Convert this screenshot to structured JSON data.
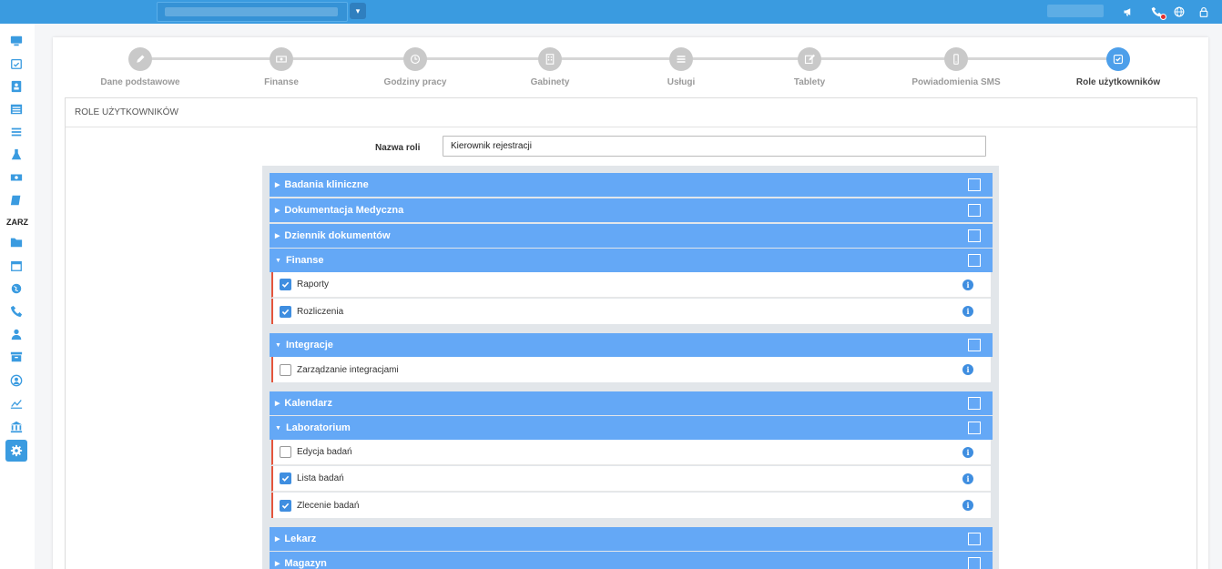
{
  "topbar": {
    "caret": "▾"
  },
  "sidebar": {
    "section_label": "ZARZ"
  },
  "stepper": {
    "steps": [
      {
        "label": "Dane podstawowe",
        "icon": "pencil-icon"
      },
      {
        "label": "Finanse",
        "icon": "money-icon"
      },
      {
        "label": "Godziny pracy",
        "icon": "clock-icon"
      },
      {
        "label": "Gabinety",
        "icon": "building-icon"
      },
      {
        "label": "Usługi",
        "icon": "list-icon"
      },
      {
        "label": "Tablety",
        "icon": "edit-icon"
      },
      {
        "label": "Powiadomienia SMS",
        "icon": "phone-icon"
      },
      {
        "label": "Role użytkowników",
        "icon": "check-square-icon"
      }
    ],
    "active_index": 7
  },
  "panel": {
    "title": "Role użytkowników",
    "role_label": "Nazwa roli",
    "role_value": "Kierownik rejestracji"
  },
  "groups": [
    {
      "label": "Badania kliniczne",
      "expanded": false,
      "checked": false
    },
    {
      "label": "Dokumentacja Medyczna",
      "expanded": false,
      "checked": false
    },
    {
      "label": "Dziennik dokumentów",
      "expanded": false,
      "checked": false
    },
    {
      "label": "Finanse",
      "expanded": true,
      "checked": false,
      "items": [
        {
          "label": "Raporty",
          "checked": true
        },
        {
          "label": "Rozliczenia",
          "checked": true
        }
      ]
    },
    {
      "label": "Integracje",
      "expanded": true,
      "checked": false,
      "items": [
        {
          "label": "Zarządzanie integracjami",
          "checked": false
        }
      ]
    },
    {
      "label": "Kalendarz",
      "expanded": false,
      "checked": false
    },
    {
      "label": "Laboratorium",
      "expanded": true,
      "checked": false,
      "items": [
        {
          "label": "Edycja badań",
          "checked": false
        },
        {
          "label": "Lista badań",
          "checked": true
        },
        {
          "label": "Zlecenie badań",
          "checked": true
        }
      ]
    },
    {
      "label": "Lekarz",
      "expanded": false,
      "checked": false
    },
    {
      "label": "Magazyn",
      "expanded": false,
      "checked": false
    }
  ],
  "colors": {
    "topbar": "#3a9be0",
    "group_header": "#64a8f6",
    "accent_border": "#e4553c",
    "checkbox_checked": "#3f8ee0"
  },
  "info_symbol": "i"
}
